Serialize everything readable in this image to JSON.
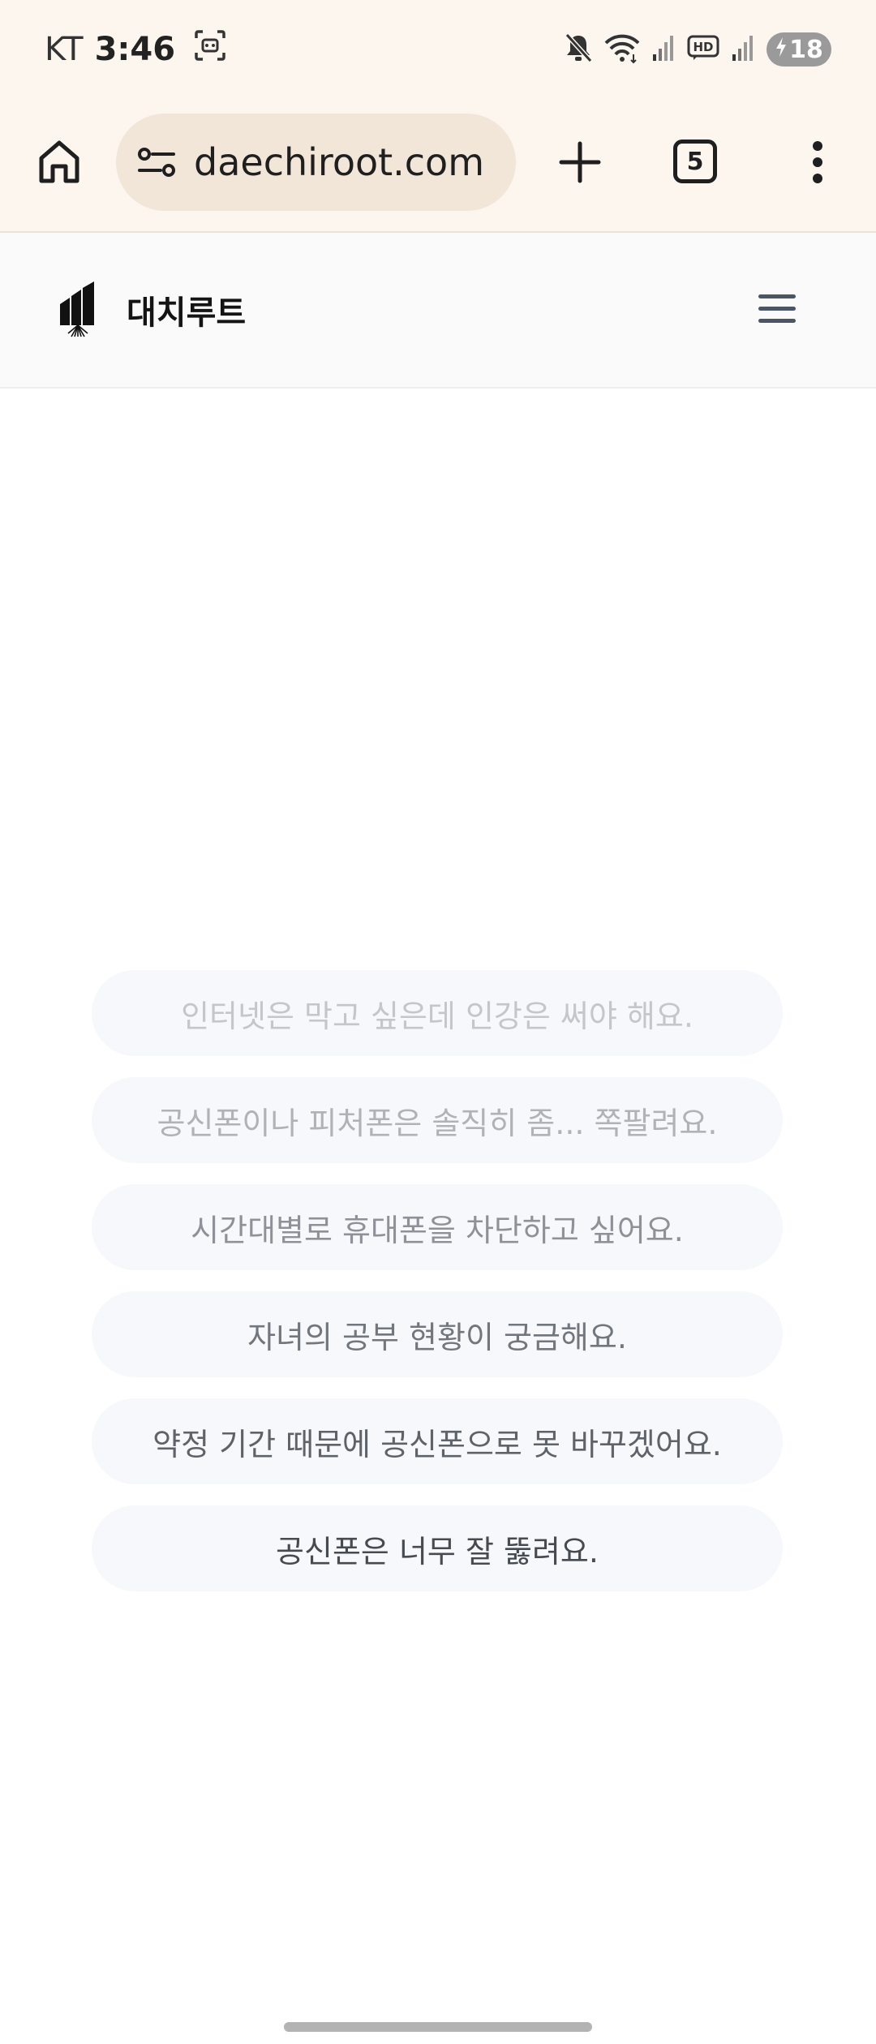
{
  "status_bar": {
    "carrier": "KT",
    "time": "3:46",
    "battery_level": "18"
  },
  "browser": {
    "url": "daechiroot.com",
    "tab_count": "5"
  },
  "site": {
    "name": "대치루트"
  },
  "messages": [
    {
      "text": "인터넷은 막고 싶은데 인강은 써야 해요.",
      "color": "#c3c6ca"
    },
    {
      "text": "공신폰이나 피처폰은 솔직히 좀... 쪽팔려요.",
      "color": "#afb3b8"
    },
    {
      "text": "시간대별로 휴대폰을 차단하고 싶어요.",
      "color": "#8e9298"
    },
    {
      "text": "자녀의 공부 현황이 궁금해요.",
      "color": "#72767d"
    },
    {
      "text": "약정 기간 때문에 공신폰으로 못 바꾸겠어요.",
      "color": "#5e6269"
    },
    {
      "text": "공신폰은 너무 잘 뚫려요.",
      "color": "#464a51"
    }
  ]
}
